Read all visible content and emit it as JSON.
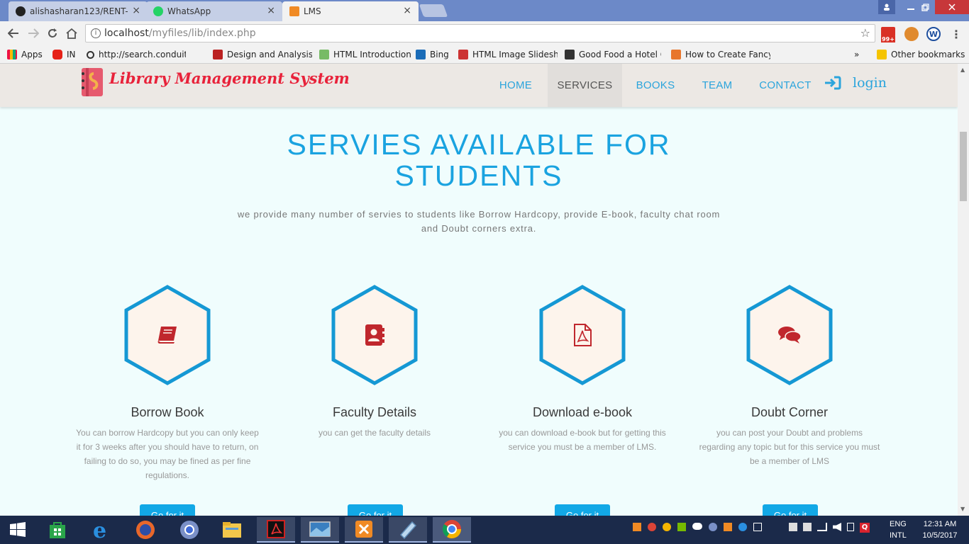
{
  "browser": {
    "tabs": [
      {
        "title": "alishasharan123/RENT-IT",
        "close": "×"
      },
      {
        "title": "WhatsApp",
        "close": "×"
      },
      {
        "title": "LMS",
        "close": "×"
      }
    ],
    "url_host": "localhost",
    "url_path": "/myfiles/lib/index.php",
    "mail_badge": "99+",
    "bookmarks": [
      {
        "label": "Apps"
      },
      {
        "label": "IN"
      },
      {
        "label": "http://search.conduit"
      },
      {
        "label": "Design and Analysis o"
      },
      {
        "label": "HTML Introduction"
      },
      {
        "label": "Bing"
      },
      {
        "label": "HTML Image Slidesho"
      },
      {
        "label": "Good Food a Hotel C"
      },
      {
        "label": "How to Create Fancy"
      }
    ],
    "more_bookmarks": "»",
    "other_bookmarks": "Other bookmarks"
  },
  "site": {
    "logo_text": "Library Management System",
    "nav": [
      {
        "label": "HOME"
      },
      {
        "label": "SERVICES"
      },
      {
        "label": "BOOKS"
      },
      {
        "label": "TEAM"
      },
      {
        "label": "CONTACT"
      }
    ],
    "login_label": "login",
    "headline": "SERVIES AVAILABLE FOR STUDENTS",
    "subtitle": "we provide many number of servies to students like Borrow Hardcopy, provide E-book, faculty chat room and Doubt corners extra.",
    "services": [
      {
        "icon": "book-icon",
        "title": "Borrow Book",
        "desc": "You can borrow Hardcopy but you can only keep it for 3 weeks after you should have to return, on failing to do so, you may be fined as per fine regulations.",
        "button": "Go for it"
      },
      {
        "icon": "contact-card-icon",
        "title": "Faculty Details",
        "desc": "you can get the faculty details",
        "button": "Go for it"
      },
      {
        "icon": "pdf-file-icon",
        "title": "Download e-book",
        "desc": "you can download e-book but for getting this service you must be a member of LMS.",
        "button": "Go for it"
      },
      {
        "icon": "chat-bubbles-icon",
        "title": "Doubt Corner",
        "desc": "you can post your Doubt and problems regarding any topic but for this service you must be a member of LMS",
        "button": "Go for it"
      }
    ]
  },
  "colors": {
    "accent": "#1aa3e0",
    "icon_red": "#c0272d",
    "hex_fill": "#fdf4ec",
    "button": "#12a8e6"
  },
  "taskbar": {
    "lang_line1": "ENG",
    "lang_line2": "INTL",
    "time": "12:31 AM",
    "date": "10/5/2017"
  }
}
